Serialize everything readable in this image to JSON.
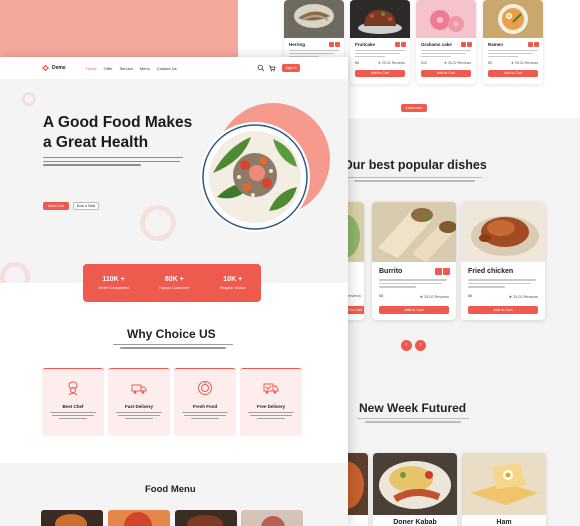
{
  "nav": {
    "brand": "Deme",
    "links": [
      "Home",
      "Offer",
      "Service",
      "Menu",
      "Contact Us"
    ],
    "signup": "Sign In"
  },
  "hero": {
    "title_line1": "A Good Food Makes",
    "title_line2": "a Great Health",
    "primary_button": "Add to Cart",
    "secondary_button": "Book a Table"
  },
  "stats": [
    {
      "value": "110K +",
      "label": "Order Completed"
    },
    {
      "value": "80K +",
      "label": "Happy Customer"
    },
    {
      "value": "10K +",
      "label": "Regular Visitor"
    }
  ],
  "why": {
    "title": "Why Choice US",
    "features": [
      {
        "title": "Best Chef",
        "icon": "chef-icon"
      },
      {
        "title": "Fast Delivery",
        "icon": "delivery-truck-icon"
      },
      {
        "title": "Fresh Food",
        "icon": "fresh-food-icon"
      },
      {
        "title": "Free Delivery",
        "icon": "free-delivery-icon"
      }
    ]
  },
  "menu": {
    "title": "Food Menu"
  },
  "top_cards": [
    {
      "name": "Herring",
      "meta_left": "$12",
      "meta_right": "★ 25.02 Reviews",
      "button": "Add to Cart"
    },
    {
      "name": "Fruitcake",
      "meta_left": "$8",
      "meta_right": "★ 25.02 Reviews",
      "button": "Add to Cart"
    },
    {
      "name": "Grahams cake",
      "meta_left": "$10",
      "meta_right": "★ 25.02 Reviews",
      "button": "Add to Cart"
    },
    {
      "name": "Ramen",
      "meta_left": "$9",
      "meta_right": "★ 25.02 Reviews",
      "button": "Add to Cart"
    }
  ],
  "load_more": "Load more",
  "popular": {
    "title": "Our best popular dishes",
    "cards": [
      {
        "name": "Burrito",
        "meta_left": "$8",
        "meta_right": "★ 25.02 Reviews",
        "button": "Add to Cart"
      },
      {
        "name": "Fried chicken",
        "meta_left": "$8",
        "meta_right": "★ 25.02 Reviews",
        "button": "Add to Cart"
      }
    ],
    "partial_meta": "Reviews",
    "partial_button": "d to Cart"
  },
  "slider": {
    "prev": "‹",
    "next": "›"
  },
  "new_week": {
    "title": "New Week Futured",
    "cards": [
      {
        "name": "Doner Kabab"
      },
      {
        "name": "Ham"
      }
    ]
  },
  "colors": {
    "accent": "#ef5a4e",
    "salmon": "#f5a99c",
    "pink_bg": "#fdeeed"
  }
}
